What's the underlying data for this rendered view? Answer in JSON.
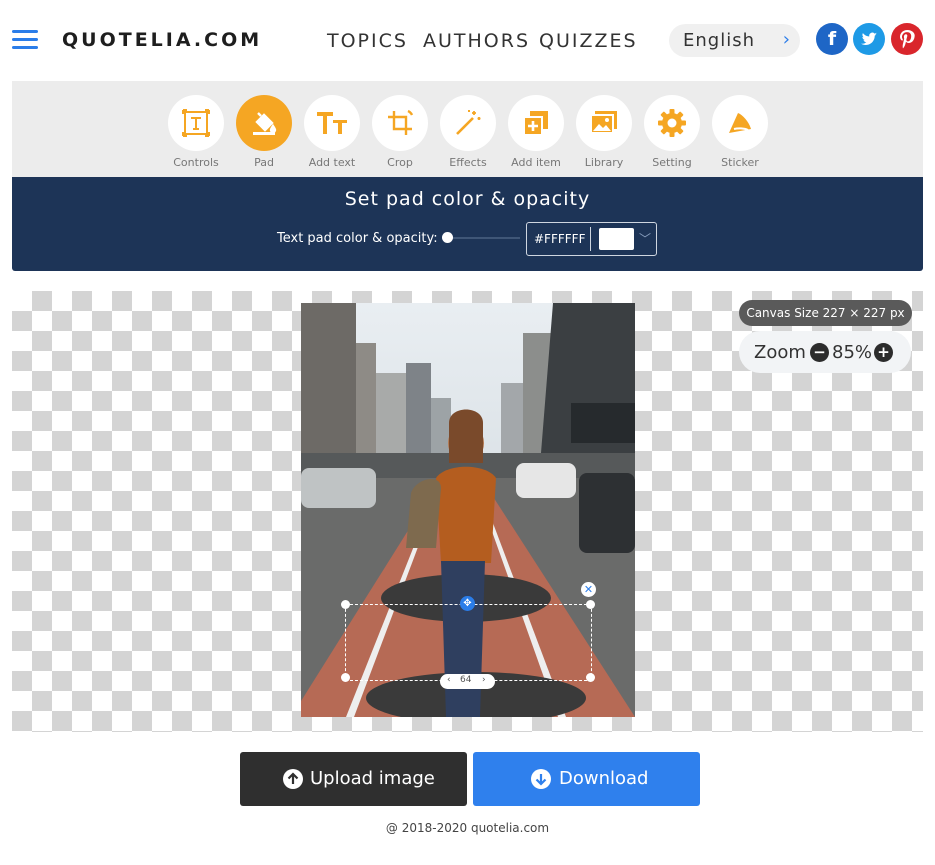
{
  "header": {
    "logo": "QUOTELIA.COM",
    "nav": [
      "TOPICS",
      "AUTHORS",
      "QUIZZES"
    ],
    "language": "English",
    "social": [
      "facebook",
      "twitter",
      "pinterest"
    ]
  },
  "toolbar": {
    "items": [
      {
        "label": "Controls",
        "icon": "text-frame-icon",
        "active": false
      },
      {
        "label": "Pad",
        "icon": "paint-bucket-icon",
        "active": true
      },
      {
        "label": "Add text",
        "icon": "text-size-icon",
        "active": false
      },
      {
        "label": "Crop",
        "icon": "crop-icon",
        "active": false
      },
      {
        "label": "Effects",
        "icon": "magic-wand-icon",
        "active": false
      },
      {
        "label": "Add item",
        "icon": "add-item-icon",
        "active": false
      },
      {
        "label": "Library",
        "icon": "image-library-icon",
        "active": false
      },
      {
        "label": "Setting",
        "icon": "gear-icon",
        "active": false
      },
      {
        "label": "Sticker",
        "icon": "sticker-icon",
        "active": false
      }
    ]
  },
  "pad": {
    "title": "Set pad color & opacity",
    "label": "Text pad color & opacity:",
    "opacity": 0,
    "color_hex": "#FFFFFF"
  },
  "canvas": {
    "size_label": "Canvas Size 227 × 227 px",
    "zoom_label": "Zoom",
    "zoom_value": "85%",
    "stepper_value": "64"
  },
  "actions": {
    "upload_label": "Upload image",
    "download_label": "Download"
  },
  "footer": "@ 2018-2020 quotelia.com",
  "colors": {
    "accent": "#2b7de9",
    "orange": "#f5a623",
    "pad_bar": "#1d3457",
    "upload_bg": "#2f2f2f",
    "download_bg": "#2f80ed"
  }
}
